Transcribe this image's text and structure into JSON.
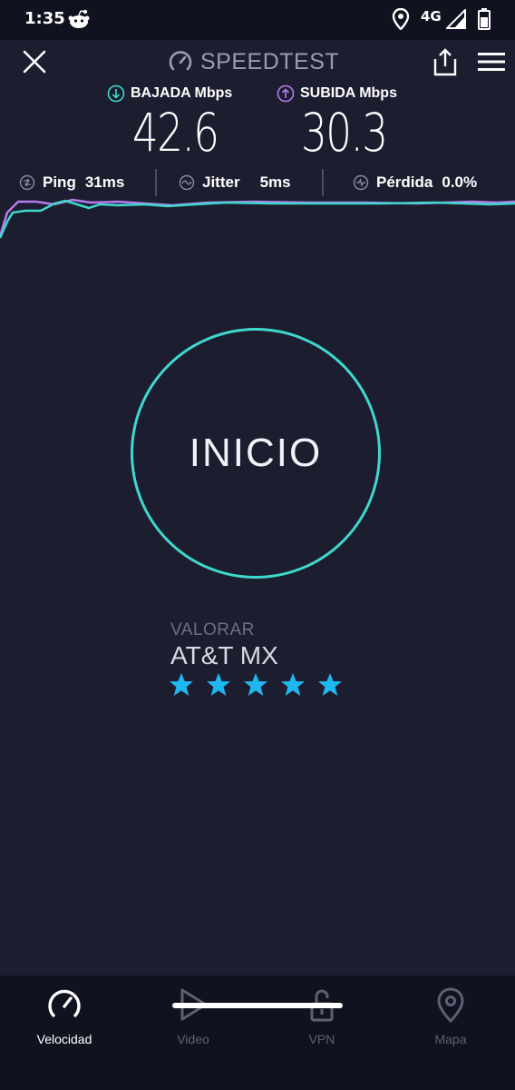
{
  "status_bar": {
    "time": "1:35",
    "network": "4G"
  },
  "header": {
    "title": "SPEEDTEST"
  },
  "results": {
    "download_label": "BAJADA Mbps",
    "download_value": "42.6",
    "upload_label": "SUBIDA Mbps",
    "upload_value": "30.3"
  },
  "stats": {
    "ping_label": "Ping",
    "ping_value": "31ms",
    "jitter_label": "Jitter",
    "jitter_value": "5ms",
    "loss_label": "Pérdida",
    "loss_value": "0.0%"
  },
  "start_button": {
    "label": "INICIO"
  },
  "rating": {
    "label": "VALORAR",
    "provider": "AT&T MX",
    "stars": 5
  },
  "bottom_nav": {
    "items": [
      {
        "label": "Velocidad",
        "icon": "speed-gauge-icon",
        "active": true
      },
      {
        "label": "Video",
        "icon": "play-icon",
        "active": false
      },
      {
        "label": "VPN",
        "icon": "lock-icon",
        "active": false
      },
      {
        "label": "Mapa",
        "icon": "map-pin-icon",
        "active": false
      }
    ]
  },
  "colors": {
    "background": "#1c1e30",
    "download_accent": "#3fd8cc",
    "upload_accent": "#b77bf0",
    "star": "#1fb7f0"
  }
}
